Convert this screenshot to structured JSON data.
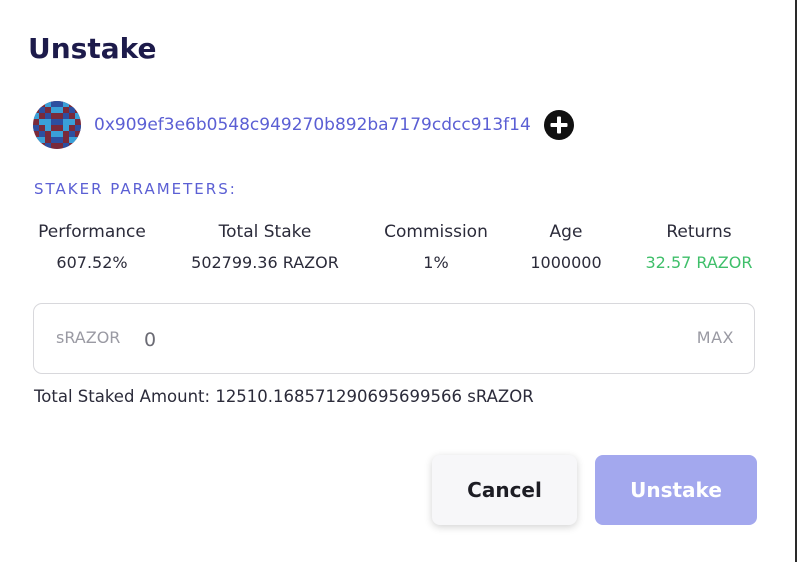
{
  "dialog": {
    "title": "Unstake"
  },
  "staker": {
    "address": "0x909ef3e6b0548c949270b892ba7179cdcc913f14",
    "avatar_icon": "identicon-avatar",
    "add_icon": "plus-circle-icon"
  },
  "parameters": {
    "section_label": "STAKER PARAMETERS:",
    "items": [
      {
        "label": "Performance",
        "value": "607.52%"
      },
      {
        "label": "Total Stake",
        "value": "502799.36 RAZOR"
      },
      {
        "label": "Commission",
        "value": "1%"
      },
      {
        "label": "Age",
        "value": "1000000"
      },
      {
        "label": "Returns",
        "value": "32.57 RAZOR"
      }
    ]
  },
  "amount": {
    "token_label": "sRAZOR",
    "placeholder": "0",
    "value": "",
    "max_label": "MAX"
  },
  "total_staked": "Total Staked Amount: 12510.168571290695699566 sRAZOR",
  "actions": {
    "cancel_label": "Cancel",
    "unstake_label": "Unstake"
  },
  "colors": {
    "title": "#1d1b4b",
    "accent": "#5b5fd4",
    "returns_green": "#3fbf6a",
    "unstake_button_bg": "#a3a8ee",
    "cancel_button_bg": "#f7f7f9"
  }
}
